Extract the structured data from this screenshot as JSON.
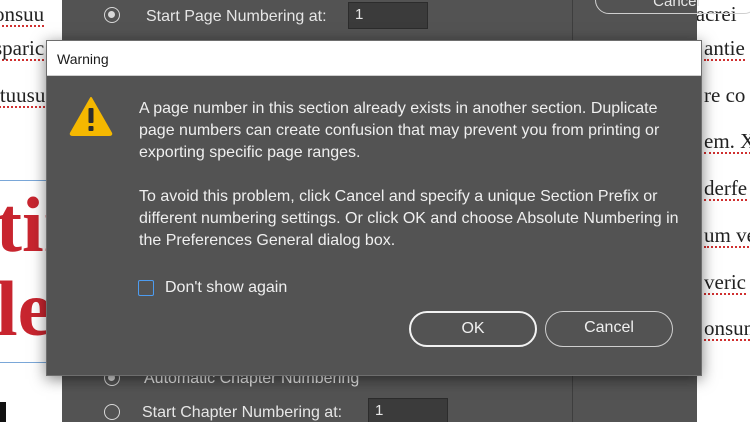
{
  "document": {
    "left_lines": [
      "onsuu",
      "sparic",
      "ituusu"
    ],
    "right_lines": [
      "d acrei",
      "antie",
      "re co",
      "em. X",
      "derfe",
      "um ve",
      "veric",
      "onsun"
    ],
    "big_lines": [
      "tir",
      "le"
    ]
  },
  "numbering_dialog": {
    "start_page_label": "Start Page Numbering at:",
    "start_page_value": "1",
    "auto_chapter_label": "Automatic Chapter Numbering",
    "start_chapter_label": "Start Chapter Numbering at:",
    "start_chapter_value": "1",
    "cancel_label": "Cancel"
  },
  "warning_dialog": {
    "title": "Warning",
    "icon": "warning-triangle-icon",
    "message_paragraph_1": "A page number in this section already exists in another section. Duplicate page numbers can create confusion that may prevent you from printing or exporting specific page ranges.",
    "message_paragraph_2": "To avoid this problem, click Cancel and specify a unique Section Prefix or different numbering settings. Or click OK and choose Absolute Numbering in the Preferences General dialog box.",
    "checkbox_label": "Don't show again",
    "checkbox_checked": false,
    "ok_label": "OK",
    "cancel_label": "Cancel"
  },
  "colors": {
    "dialog_bg": "#535353",
    "warning_yellow": "#f5b800",
    "checkbox_accent": "#4d9cf0",
    "heading_red": "#c8252f"
  }
}
